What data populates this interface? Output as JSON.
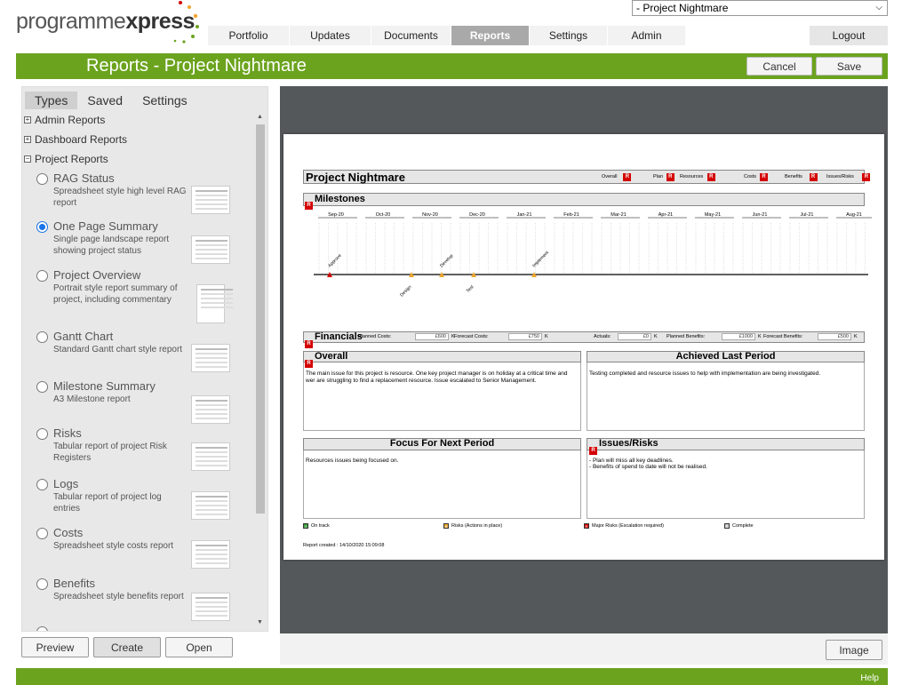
{
  "app": {
    "logo_part1": "programme",
    "logo_part2": "xpress"
  },
  "project_select": {
    "value": "- Project Nightmare"
  },
  "nav": {
    "tabs": [
      {
        "label": "Portfolio",
        "active": false
      },
      {
        "label": "Updates",
        "active": false
      },
      {
        "label": "Documents",
        "active": false
      },
      {
        "label": "Reports",
        "active": true
      },
      {
        "label": "Settings",
        "active": false
      },
      {
        "label": "Admin",
        "active": false
      }
    ],
    "logout": "Logout"
  },
  "header": {
    "title": "Reports - Project Nightmare",
    "cancel": "Cancel",
    "save": "Save"
  },
  "left": {
    "subtabs": [
      {
        "label": "Types",
        "active": true
      },
      {
        "label": "Saved",
        "active": false
      },
      {
        "label": "Settings",
        "active": false
      }
    ],
    "groups": {
      "admin": "Admin Reports",
      "dashboard": "Dashboard Reports",
      "project": "Project Reports"
    },
    "reports": [
      {
        "name": "RAG Status",
        "desc": "Spreadsheet style high level RAG report",
        "selected": false
      },
      {
        "name": "One Page Summary",
        "desc": "Single page landscape report showing project status",
        "selected": true
      },
      {
        "name": "Project Overview",
        "desc": "Portrait style report summary of project, including commentary",
        "selected": false
      },
      {
        "name": "Gantt Chart",
        "desc": "Standard Gantt chart style report",
        "selected": false
      },
      {
        "name": "Milestone Summary",
        "desc": "A3 Milestone report",
        "selected": false
      },
      {
        "name": "Risks",
        "desc": "Tabular report of project Risk Registers",
        "selected": false
      },
      {
        "name": "Logs",
        "desc": "Tabular report of project log entries",
        "selected": false
      },
      {
        "name": "Costs",
        "desc": "Spreadsheet style costs report",
        "selected": false
      },
      {
        "name": "Benefits",
        "desc": "Spreadsheet style benefits report",
        "selected": false
      }
    ],
    "buttons": {
      "preview": "Preview",
      "create": "Create",
      "open": "Open"
    }
  },
  "preview": {
    "image_button": "Image",
    "report": {
      "project_title": "Project Nightmare",
      "rag_labels": [
        "Overall",
        "Plan",
        "Resources",
        "Costs",
        "Benefits",
        "Issues/Risks"
      ],
      "rag_letter": "R",
      "milestones_title": "Milestones",
      "months": [
        "Sep-20",
        "Oct-20",
        "Nov-20",
        "Dec-20",
        "Jan-21",
        "Feb-21",
        "Mar-21",
        "Apr-21",
        "May-21",
        "Jun-21",
        "Jul-21",
        "Aug-21"
      ],
      "milestones_above": [
        "Approve",
        "Develop",
        "Implement"
      ],
      "milestones_below": [
        "Design",
        "Test"
      ],
      "financials_title": "Financials",
      "financials": [
        {
          "label": "Planned Costs:",
          "value": "£600",
          "unit": "K"
        },
        {
          "label": "Forecast Costs:",
          "value": "£750",
          "unit": "K"
        },
        {
          "label": "Actuals:",
          "value": "£0",
          "unit": "K"
        },
        {
          "label": "Planned Benefits:",
          "value": "£1000",
          "unit": "K"
        },
        {
          "label": "Forecast Benefits:",
          "value": "£500",
          "unit": "K"
        }
      ],
      "overall_title": "Overall",
      "overall_text": "The main issue for this project is resource. One key project manager is on holiday at a critical time and wer are struggling to find a replacement resource. Issue escalated to Senior Management.",
      "achieved_title": "Achieved Last Period",
      "achieved_text": "Testing completed and resource issues to help with implementation are being investigated.",
      "focus_title": "Focus For Next Period",
      "focus_text": "Resources issues being focused on.",
      "issues_title": "Issues/Risks",
      "issues_line1": "- Plan will miss all key deadlines.",
      "issues_line2": "- Benefits of spend to date will not be realised.",
      "legend": [
        {
          "label": "On track",
          "color": "#2e9e2e",
          "letter": "G"
        },
        {
          "label": "Risks (Actions in place)",
          "color": "#f0a830",
          "letter": "A"
        },
        {
          "label": "Major Risks (Escalation required)",
          "color": "#d40000",
          "letter": "R"
        },
        {
          "label": "Complete",
          "color": "#cccccc",
          "letter": "C"
        }
      ],
      "created": "Report created : 14/10/2020 15:09:08"
    }
  },
  "footer": {
    "help": "Help"
  },
  "colors": {
    "brand_green": "#6ba31e",
    "rag_red": "#d40000",
    "milestone_amber": "#f0a830"
  }
}
